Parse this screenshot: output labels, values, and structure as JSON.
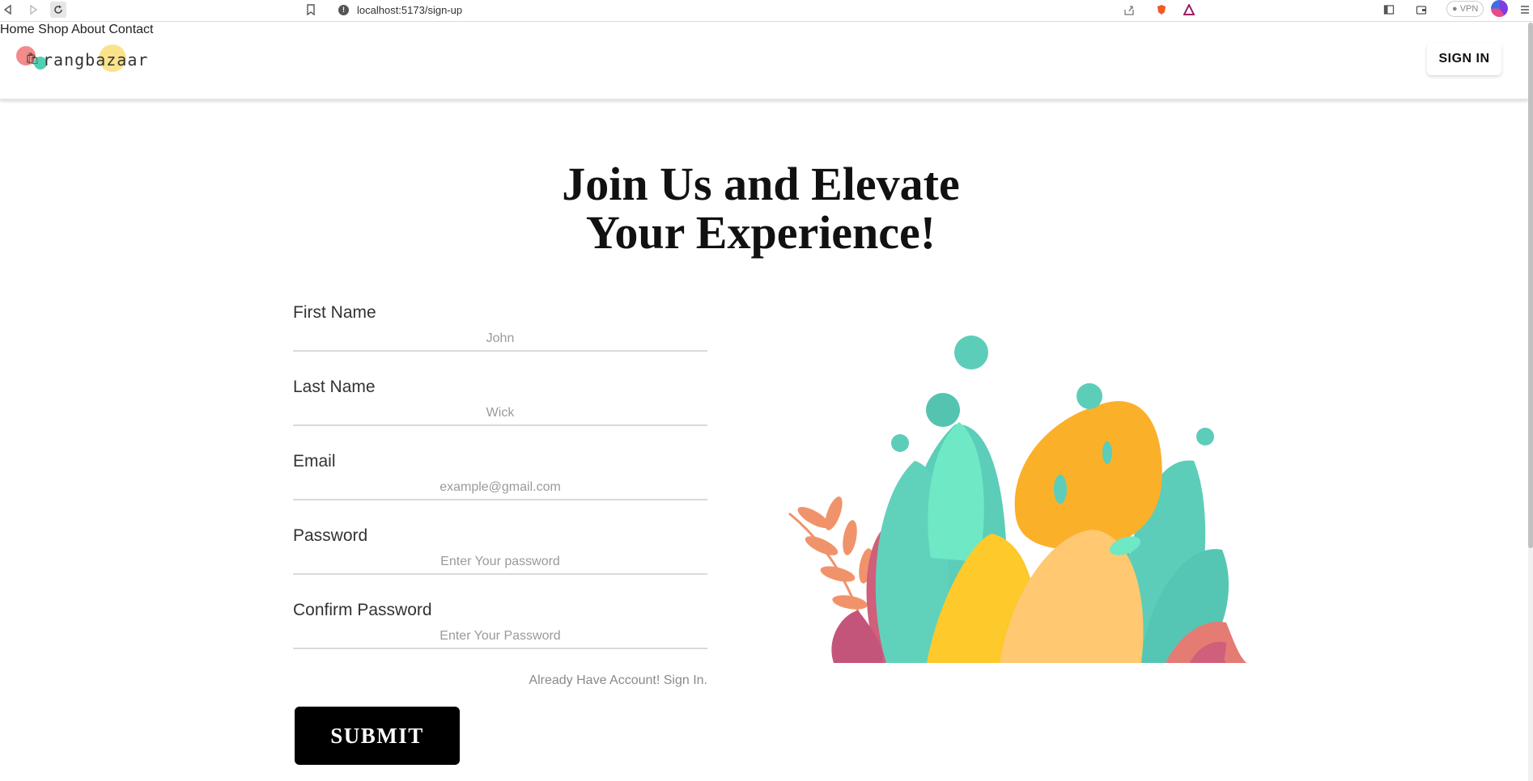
{
  "browser": {
    "url": "localhost:5173/sign-up",
    "vpn_label": "VPN"
  },
  "header": {
    "logo_text": "rangbazaar",
    "nav": [
      "Home",
      "Shop",
      "About",
      "Contact"
    ],
    "signin_label": "SIGN IN"
  },
  "hero": {
    "title_line1": "Join Us and Elevate",
    "title_line2": "Your Experience!"
  },
  "form": {
    "fields": [
      {
        "label": "First Name",
        "placeholder": "John"
      },
      {
        "label": "Last Name",
        "placeholder": "Wick"
      },
      {
        "label": "Email",
        "placeholder": "example@gmail.com"
      },
      {
        "label": "Password",
        "placeholder": "Enter Your password"
      },
      {
        "label": "Confirm Password",
        "placeholder": "Enter Your Password"
      }
    ],
    "already_text": "Already Have Account! Sign In.",
    "submit_label": "SUBMIT"
  },
  "colors": {
    "teal": "#5ccdb9",
    "mint": "#6ee8c5",
    "orange": "#fbb02a",
    "yellow": "#fdc92b",
    "peach": "#ffc871",
    "pink": "#cf5f7a",
    "coral": "#ef8a6a"
  }
}
